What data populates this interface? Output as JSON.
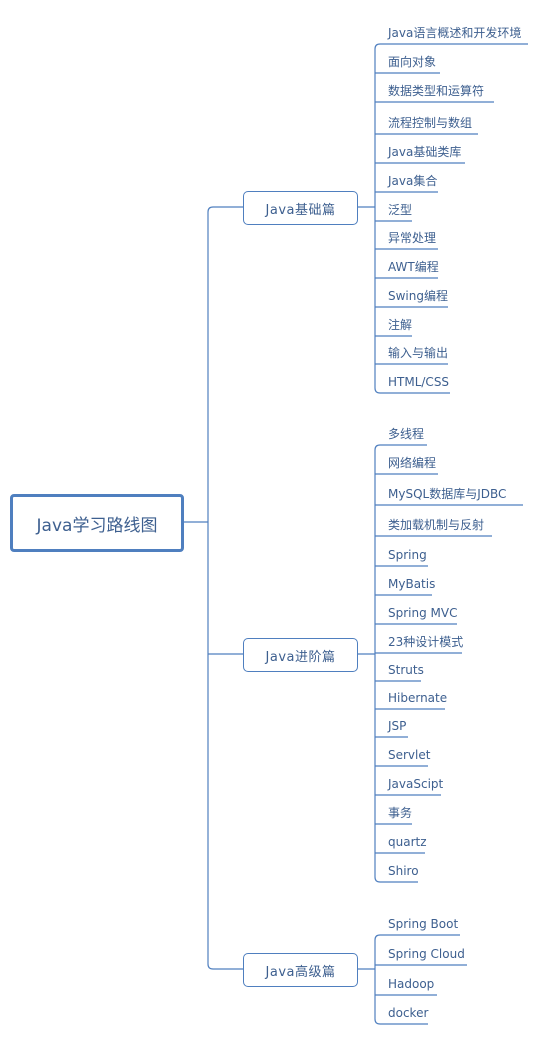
{
  "root": {
    "label": "Java学习路线图"
  },
  "line_color": "#4f7fbf",
  "text_color": "#3d5f8f",
  "branches": [
    {
      "label": "Java基础篇",
      "children": [
        "Java语言概述和开发环境",
        "面向对象",
        "数据类型和运算符",
        "流程控制与数组",
        "Java基础类库",
        "Java集合",
        "泛型",
        "异常处理",
        "AWT编程",
        "Swing编程",
        "注解",
        "输入与输出",
        "HTML/CSS"
      ]
    },
    {
      "label": "Java进阶篇",
      "children": [
        "多线程",
        "网络编程",
        "MySQL数据库与JDBC",
        "类加载机制与反射",
        "Spring",
        "MyBatis",
        "Spring MVC",
        "23种设计模式",
        "Struts",
        "Hibernate",
        "JSP",
        "Servlet",
        "JavaScipt",
        "事务",
        "quartz",
        "Shiro"
      ]
    },
    {
      "label": "Java高级篇",
      "children": [
        "Spring Boot",
        "Spring Cloud",
        "Hadoop",
        "docker"
      ]
    }
  ]
}
